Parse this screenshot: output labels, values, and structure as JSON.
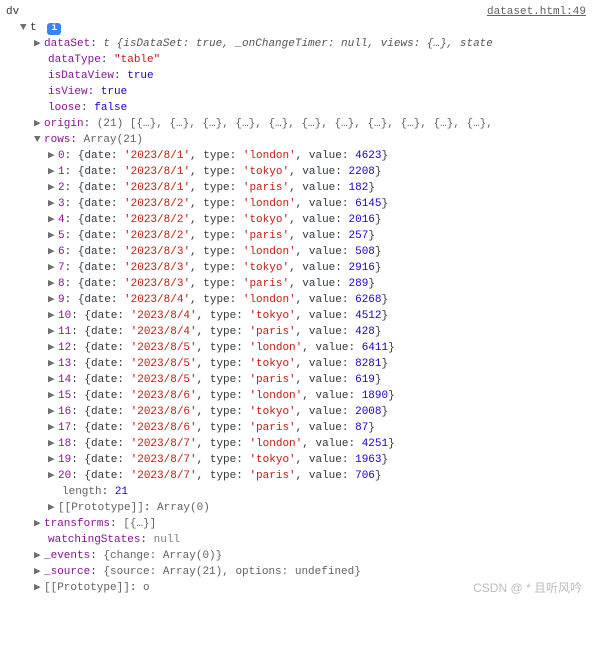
{
  "source_link": "dataset.html:49",
  "root_var": "dv",
  "obj_label": "t",
  "badge": "i",
  "dataSet_summary": "t {isDataSet: true, _onChangeTimer: null, views: {…}, state",
  "props": {
    "dataType": "\"table\"",
    "isDataView": "true",
    "isView": "true",
    "loose": "false"
  },
  "origin_summary": "(21) [{…}, {…}, {…}, {…}, {…}, {…}, {…}, {…}, {…}, {…}, {…},",
  "rows_label": "Array(21)",
  "rows": [
    {
      "idx": 0,
      "date": "2023/8/1",
      "type": "london",
      "value": 4623
    },
    {
      "idx": 1,
      "date": "2023/8/1",
      "type": "tokyo",
      "value": 2208
    },
    {
      "idx": 2,
      "date": "2023/8/1",
      "type": "paris",
      "value": 182
    },
    {
      "idx": 3,
      "date": "2023/8/2",
      "type": "london",
      "value": 6145
    },
    {
      "idx": 4,
      "date": "2023/8/2",
      "type": "tokyo",
      "value": 2016
    },
    {
      "idx": 5,
      "date": "2023/8/2",
      "type": "paris",
      "value": 257
    },
    {
      "idx": 6,
      "date": "2023/8/3",
      "type": "london",
      "value": 508
    },
    {
      "idx": 7,
      "date": "2023/8/3",
      "type": "tokyo",
      "value": 2916
    },
    {
      "idx": 8,
      "date": "2023/8/3",
      "type": "paris",
      "value": 289
    },
    {
      "idx": 9,
      "date": "2023/8/4",
      "type": "london",
      "value": 6268
    },
    {
      "idx": 10,
      "date": "2023/8/4",
      "type": "tokyo",
      "value": 4512
    },
    {
      "idx": 11,
      "date": "2023/8/4",
      "type": "paris",
      "value": 428
    },
    {
      "idx": 12,
      "date": "2023/8/5",
      "type": "london",
      "value": 6411
    },
    {
      "idx": 13,
      "date": "2023/8/5",
      "type": "tokyo",
      "value": 8281
    },
    {
      "idx": 14,
      "date": "2023/8/5",
      "type": "paris",
      "value": 619
    },
    {
      "idx": 15,
      "date": "2023/8/6",
      "type": "london",
      "value": 1890
    },
    {
      "idx": 16,
      "date": "2023/8/6",
      "type": "tokyo",
      "value": 2008
    },
    {
      "idx": 17,
      "date": "2023/8/6",
      "type": "paris",
      "value": 87
    },
    {
      "idx": 18,
      "date": "2023/8/7",
      "type": "london",
      "value": 4251
    },
    {
      "idx": 19,
      "date": "2023/8/7",
      "type": "tokyo",
      "value": 1963
    },
    {
      "idx": 20,
      "date": "2023/8/7",
      "type": "paris",
      "value": 706
    }
  ],
  "length_val": 21,
  "proto_arr": "Array(0)",
  "transforms_summary": "[{…}]",
  "watchingStates": "null",
  "events_summary": "{change: Array(0)}",
  "source_summary": "{source: Array(21), options: undefined}",
  "proto_o": "o",
  "labels": {
    "dataSet": "dataSet",
    "dataType": "dataType",
    "isDataView": "isDataView",
    "isView": "isView",
    "loose": "loose",
    "origin": "origin",
    "rows": "rows",
    "length": "length",
    "prototype": "[[Prototype]]",
    "transforms": "transforms",
    "watchingStates": "watchingStates",
    "events": "_events",
    "source": "_source"
  },
  "watermark": "CSDN @ * 且听风吟"
}
